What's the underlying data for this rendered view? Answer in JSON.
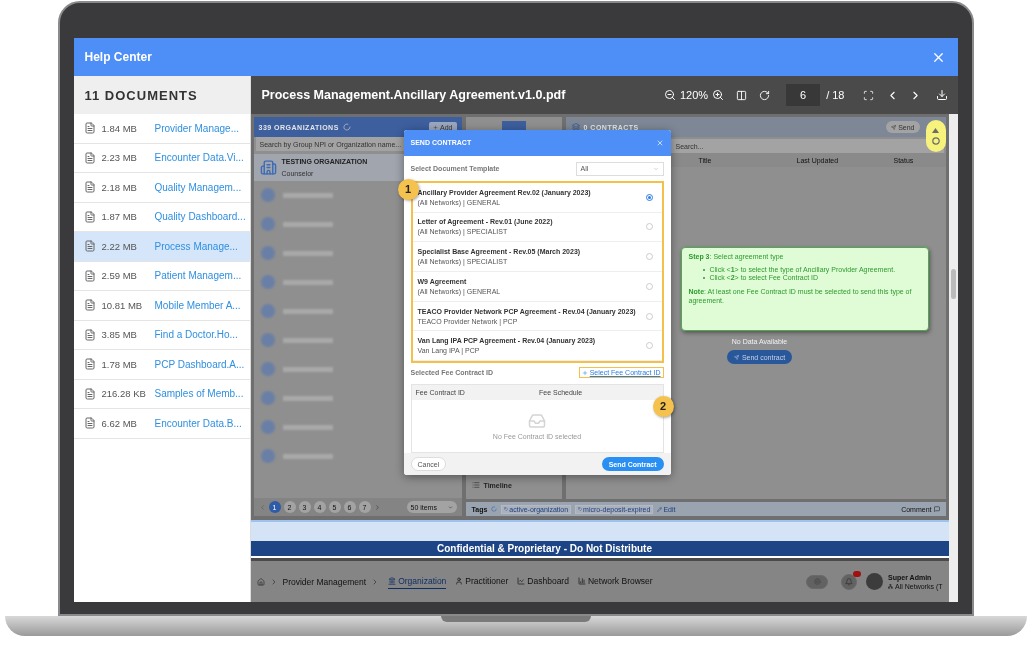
{
  "window": {
    "title": "Help Center"
  },
  "sidebar": {
    "title": "11 DOCUMENTS",
    "items": [
      {
        "size": "1.84 MB",
        "name": "Provider Manage...",
        "selected": false
      },
      {
        "size": "2.23 MB",
        "name": "Encounter Data.Vi...",
        "selected": false
      },
      {
        "size": "2.18 MB",
        "name": "Quality Managem...",
        "selected": false
      },
      {
        "size": "1.87 MB",
        "name": "Quality Dashboard...",
        "selected": false
      },
      {
        "size": "2.22 MB",
        "name": "Process Manage...",
        "selected": true
      },
      {
        "size": "2.59 MB",
        "name": "Patient Managem...",
        "selected": false
      },
      {
        "size": "10.81 MB",
        "name": "Mobile Member A...",
        "selected": false
      },
      {
        "size": "3.85 MB",
        "name": "Find a Doctor.Ho...",
        "selected": false
      },
      {
        "size": "1.78 MB",
        "name": "PCP Dashboard.A...",
        "selected": false
      },
      {
        "size": "216.28 KB",
        "name": "Samples of Memb...",
        "selected": false
      },
      {
        "size": "6.62 MB",
        "name": "Encounter Data.B...",
        "selected": false
      }
    ]
  },
  "viewer": {
    "file_name": "Process Management.Ancillary Agreement.v1.0.pdf",
    "zoom": "120%",
    "page": "6",
    "page_count": "/ 18"
  },
  "organizations": {
    "title": "339 ORGANIZATIONS",
    "add_button": "Add",
    "search_placeholder": "Search by Group NPI or Organization name...",
    "selected_org": {
      "name": "TESTING ORGANIZATION",
      "type": "Counselor"
    },
    "pages": [
      {
        "label": "1",
        "selected": true
      },
      {
        "label": "2",
        "selected": false
      },
      {
        "label": "3",
        "selected": false
      },
      {
        "label": "4",
        "selected": false
      },
      {
        "label": "5",
        "selected": false
      },
      {
        "label": "6",
        "selected": false
      },
      {
        "label": "7",
        "selected": false
      }
    ],
    "page_size": "50 items"
  },
  "timeline": {
    "title": "Timeline"
  },
  "contracts": {
    "title": "0 CONTRACTS",
    "send_button": "Send",
    "search_placeholder": "Search...",
    "columns": [
      "Title",
      "Last Updated",
      "Status"
    ],
    "empty": "No Data Available",
    "send_contract": "Send contract"
  },
  "tags": {
    "label": "Tags",
    "items": [
      "active-organization",
      "micro-deposit-expired"
    ],
    "edit": "Edit",
    "comment": "Comment"
  },
  "dialog": {
    "title": "SEND CONTRACT",
    "template_label": "Select Document Template",
    "filter": "All",
    "template_marker": "1",
    "templates": [
      {
        "name": "Ancillary Provider Agreement Rev.02 (January 2023)",
        "detail": "(All Networks) | GENERAL",
        "selected": true
      },
      {
        "name": "Letter of Agreement - Rev.01 (June 2022)",
        "detail": "(All Networks) | SPECIALIST",
        "selected": false
      },
      {
        "name": "Specialist Base Agreement - Rev.05 (March 2023)",
        "detail": "(All Networks) | SPECIALIST",
        "selected": false
      },
      {
        "name": "W9 Agreement",
        "detail": "(All Networks) | GENERAL",
        "selected": false
      },
      {
        "name": "TEACO Provider Network PCP Agreement - Rev.04 (January 2023)",
        "detail": "TEACO Provider Network | PCP",
        "selected": false
      },
      {
        "name": "Van Lang IPA PCP Agreement - Rev.04 (January 2023)",
        "detail": "Van Lang IPA | PCP",
        "selected": false
      }
    ],
    "fee_label": "Selected Fee Contract ID",
    "fee_link": "Select Fee Contract ID",
    "fee_marker": "2",
    "fee_columns": [
      "Fee Contract ID",
      "Fee Schedule"
    ],
    "fee_empty": "No Fee Contract ID selected",
    "cancel": "Cancel",
    "submit": "Send Contract"
  },
  "callout": {
    "heading": "**Step 3**: Select agreement type",
    "bullets": [
      "Click <**1**> to select the type of Ancillary Provider Agreement.",
      "Click <**2**> to select Fee Contract ID"
    ],
    "note": "**Note**: At least one Fee Contract ID must be selected to send this type of agreement."
  },
  "banner": "Confidential & Proprietary - Do Not Distribute",
  "nav": {
    "breadcrumb": "Provider Management",
    "tabs": [
      {
        "label": "Organization",
        "kind": "organization",
        "selected": true
      },
      {
        "label": "Practitioner",
        "kind": "practitioner",
        "selected": false
      },
      {
        "label": "Dashboard",
        "kind": "dashboard",
        "selected": false
      },
      {
        "label": "Network Browser",
        "kind": "network",
        "selected": false
      }
    ],
    "user": {
      "name": "Super Admin",
      "network": "All Networks (T"
    }
  }
}
